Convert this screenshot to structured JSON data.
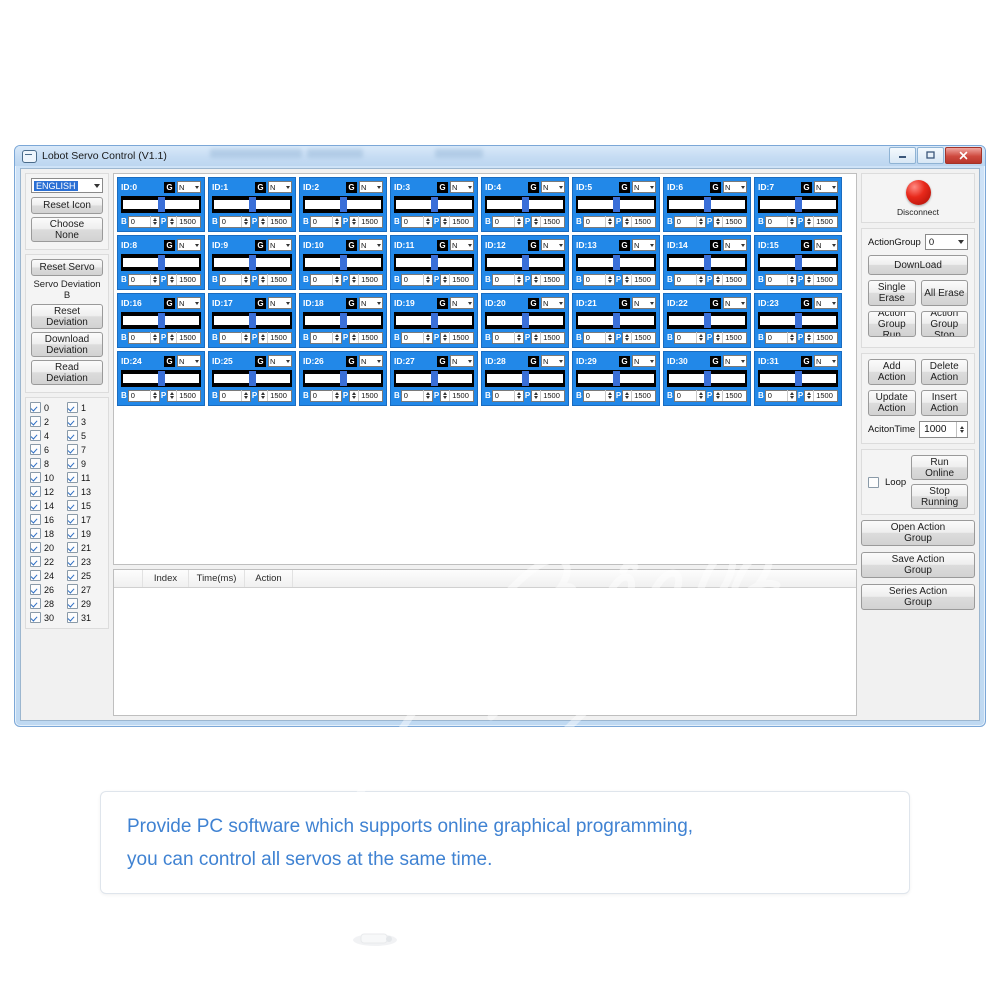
{
  "window": {
    "title": "Lobot Servo Control (V1.1)",
    "icon": "window-app-icon",
    "controls": {
      "minimize": "minimize-icon",
      "maximize": "maximize-icon",
      "close": "close-icon"
    }
  },
  "left_sidebar": {
    "language": {
      "value": "ENGLISH",
      "caret": "chevron-down-icon"
    },
    "buttons": [
      {
        "name": "reset-icon-button",
        "label": "Reset Icon",
        "lines": [
          "Reset Icon"
        ]
      },
      {
        "name": "choose-none-button",
        "label": "Choose None",
        "lines": [
          "Choose",
          "None"
        ]
      },
      {
        "name": "reset-servo-button",
        "label": "Reset Servo",
        "lines": [
          "Reset Servo"
        ]
      }
    ],
    "deviation_label": "Servo Deviation B",
    "deviation_buttons": [
      {
        "name": "reset-deviation-button",
        "lines": [
          "Reset",
          "Deviation"
        ]
      },
      {
        "name": "download-deviation-button",
        "lines": [
          "Download",
          "Deviation"
        ]
      },
      {
        "name": "read-deviation-button",
        "lines": [
          "Read",
          "Deviation"
        ]
      }
    ],
    "servo_checkboxes": [
      {
        "label": "0",
        "checked": true
      },
      {
        "label": "1",
        "checked": true
      },
      {
        "label": "2",
        "checked": true
      },
      {
        "label": "3",
        "checked": true
      },
      {
        "label": "4",
        "checked": true
      },
      {
        "label": "5",
        "checked": true
      },
      {
        "label": "6",
        "checked": true
      },
      {
        "label": "7",
        "checked": true
      },
      {
        "label": "8",
        "checked": true
      },
      {
        "label": "9",
        "checked": true
      },
      {
        "label": "10",
        "checked": true
      },
      {
        "label": "11",
        "checked": true
      },
      {
        "label": "12",
        "checked": true
      },
      {
        "label": "13",
        "checked": true
      },
      {
        "label": "14",
        "checked": true
      },
      {
        "label": "15",
        "checked": true
      },
      {
        "label": "16",
        "checked": true
      },
      {
        "label": "17",
        "checked": true
      },
      {
        "label": "18",
        "checked": true
      },
      {
        "label": "19",
        "checked": true
      },
      {
        "label": "20",
        "checked": true
      },
      {
        "label": "21",
        "checked": true
      },
      {
        "label": "22",
        "checked": true
      },
      {
        "label": "23",
        "checked": true
      },
      {
        "label": "24",
        "checked": true
      },
      {
        "label": "25",
        "checked": true
      },
      {
        "label": "26",
        "checked": true
      },
      {
        "label": "27",
        "checked": true
      },
      {
        "label": "28",
        "checked": true
      },
      {
        "label": "29",
        "checked": true
      },
      {
        "label": "30",
        "checked": true
      },
      {
        "label": "31",
        "checked": true
      }
    ]
  },
  "servo_cards": {
    "g_button_label": "G",
    "mode_value": "N",
    "deviation_tag": "B",
    "position_tag": "P",
    "cards": [
      {
        "id": "ID:0",
        "deviation": "0",
        "position": "1500",
        "slider_pct": 50
      },
      {
        "id": "ID:1",
        "deviation": "0",
        "position": "1500",
        "slider_pct": 50
      },
      {
        "id": "ID:2",
        "deviation": "0",
        "position": "1500",
        "slider_pct": 50
      },
      {
        "id": "ID:3",
        "deviation": "0",
        "position": "1500",
        "slider_pct": 50
      },
      {
        "id": "ID:4",
        "deviation": "0",
        "position": "1500",
        "slider_pct": 50
      },
      {
        "id": "ID:5",
        "deviation": "0",
        "position": "1500",
        "slider_pct": 50
      },
      {
        "id": "ID:6",
        "deviation": "0",
        "position": "1500",
        "slider_pct": 50
      },
      {
        "id": "ID:7",
        "deviation": "0",
        "position": "1500",
        "slider_pct": 50
      },
      {
        "id": "ID:8",
        "deviation": "0",
        "position": "1500",
        "slider_pct": 50
      },
      {
        "id": "ID:9",
        "deviation": "0",
        "position": "1500",
        "slider_pct": 50
      },
      {
        "id": "ID:10",
        "deviation": "0",
        "position": "1500",
        "slider_pct": 50
      },
      {
        "id": "ID:11",
        "deviation": "0",
        "position": "1500",
        "slider_pct": 50
      },
      {
        "id": "ID:12",
        "deviation": "0",
        "position": "1500",
        "slider_pct": 50
      },
      {
        "id": "ID:13",
        "deviation": "0",
        "position": "1500",
        "slider_pct": 50
      },
      {
        "id": "ID:14",
        "deviation": "0",
        "position": "1500",
        "slider_pct": 50
      },
      {
        "id": "ID:15",
        "deviation": "0",
        "position": "1500",
        "slider_pct": 50
      },
      {
        "id": "ID:16",
        "deviation": "0",
        "position": "1500",
        "slider_pct": 50
      },
      {
        "id": "ID:17",
        "deviation": "0",
        "position": "1500",
        "slider_pct": 50
      },
      {
        "id": "ID:18",
        "deviation": "0",
        "position": "1500",
        "slider_pct": 50
      },
      {
        "id": "ID:19",
        "deviation": "0",
        "position": "1500",
        "slider_pct": 50
      },
      {
        "id": "ID:20",
        "deviation": "0",
        "position": "1500",
        "slider_pct": 50
      },
      {
        "id": "ID:21",
        "deviation": "0",
        "position": "1500",
        "slider_pct": 50
      },
      {
        "id": "ID:22",
        "deviation": "0",
        "position": "1500",
        "slider_pct": 50
      },
      {
        "id": "ID:23",
        "deviation": "0",
        "position": "1500",
        "slider_pct": 50
      },
      {
        "id": "ID:24",
        "deviation": "0",
        "position": "1500",
        "slider_pct": 50
      },
      {
        "id": "ID:25",
        "deviation": "0",
        "position": "1500",
        "slider_pct": 50
      },
      {
        "id": "ID:26",
        "deviation": "0",
        "position": "1500",
        "slider_pct": 50
      },
      {
        "id": "ID:27",
        "deviation": "0",
        "position": "1500",
        "slider_pct": 50
      },
      {
        "id": "ID:28",
        "deviation": "0",
        "position": "1500",
        "slider_pct": 50
      },
      {
        "id": "ID:29",
        "deviation": "0",
        "position": "1500",
        "slider_pct": 50
      },
      {
        "id": "ID:30",
        "deviation": "0",
        "position": "1500",
        "slider_pct": 50
      },
      {
        "id": "ID:31",
        "deviation": "0",
        "position": "1500",
        "slider_pct": 50
      }
    ]
  },
  "right_sidebar": {
    "connection": {
      "status_label": "Disconnect",
      "led_color": "#e8291b"
    },
    "action_group": {
      "label": "ActionGroup",
      "value": "0",
      "caret": "chevron-down-icon"
    },
    "download_button": "DownLoad",
    "erase_buttons": [
      {
        "name": "single-erase-button",
        "lines": [
          "Single",
          "Erase"
        ]
      },
      {
        "name": "all-erase-button",
        "lines": [
          "All Erase"
        ]
      }
    ],
    "group_run_buttons": [
      {
        "name": "action-group-run-button",
        "lines": [
          "Action",
          "Group Run"
        ]
      },
      {
        "name": "action-group-stop-button",
        "lines": [
          "Action",
          "Group",
          "Stop"
        ]
      }
    ],
    "action_buttons": [
      {
        "name": "add-action-button",
        "lines": [
          "Add Action"
        ]
      },
      {
        "name": "delete-action-button",
        "lines": [
          "Delete",
          "Action"
        ]
      },
      {
        "name": "update-action-button",
        "lines": [
          "Update",
          "Action"
        ]
      },
      {
        "name": "insert-action-button",
        "lines": [
          "Insert",
          "Action"
        ]
      }
    ],
    "action_time": {
      "label": "AcitonTime",
      "value": "1000"
    },
    "loop": {
      "label": "Loop",
      "checked": false
    },
    "run_buttons": [
      {
        "name": "run-online-button",
        "lines": [
          "Run",
          "Online"
        ]
      },
      {
        "name": "stop-running-button",
        "lines": [
          "Stop",
          "Running"
        ]
      }
    ],
    "file_buttons": [
      {
        "name": "open-action-group-button",
        "lines": [
          "Open Action",
          "Group"
        ]
      },
      {
        "name": "save-action-group-button",
        "lines": [
          "Save Action",
          "Group"
        ]
      },
      {
        "name": "series-action-group-button",
        "lines": [
          "Series Action",
          "Group"
        ]
      }
    ]
  },
  "action_table": {
    "columns": [
      "Index",
      "Time(ms)",
      "Action"
    ],
    "rows": []
  },
  "caption": {
    "line1": "Provide PC software which supports online graphical programming,",
    "line2": "you can control all servos at the same time.",
    "color": "#3f82d2"
  }
}
